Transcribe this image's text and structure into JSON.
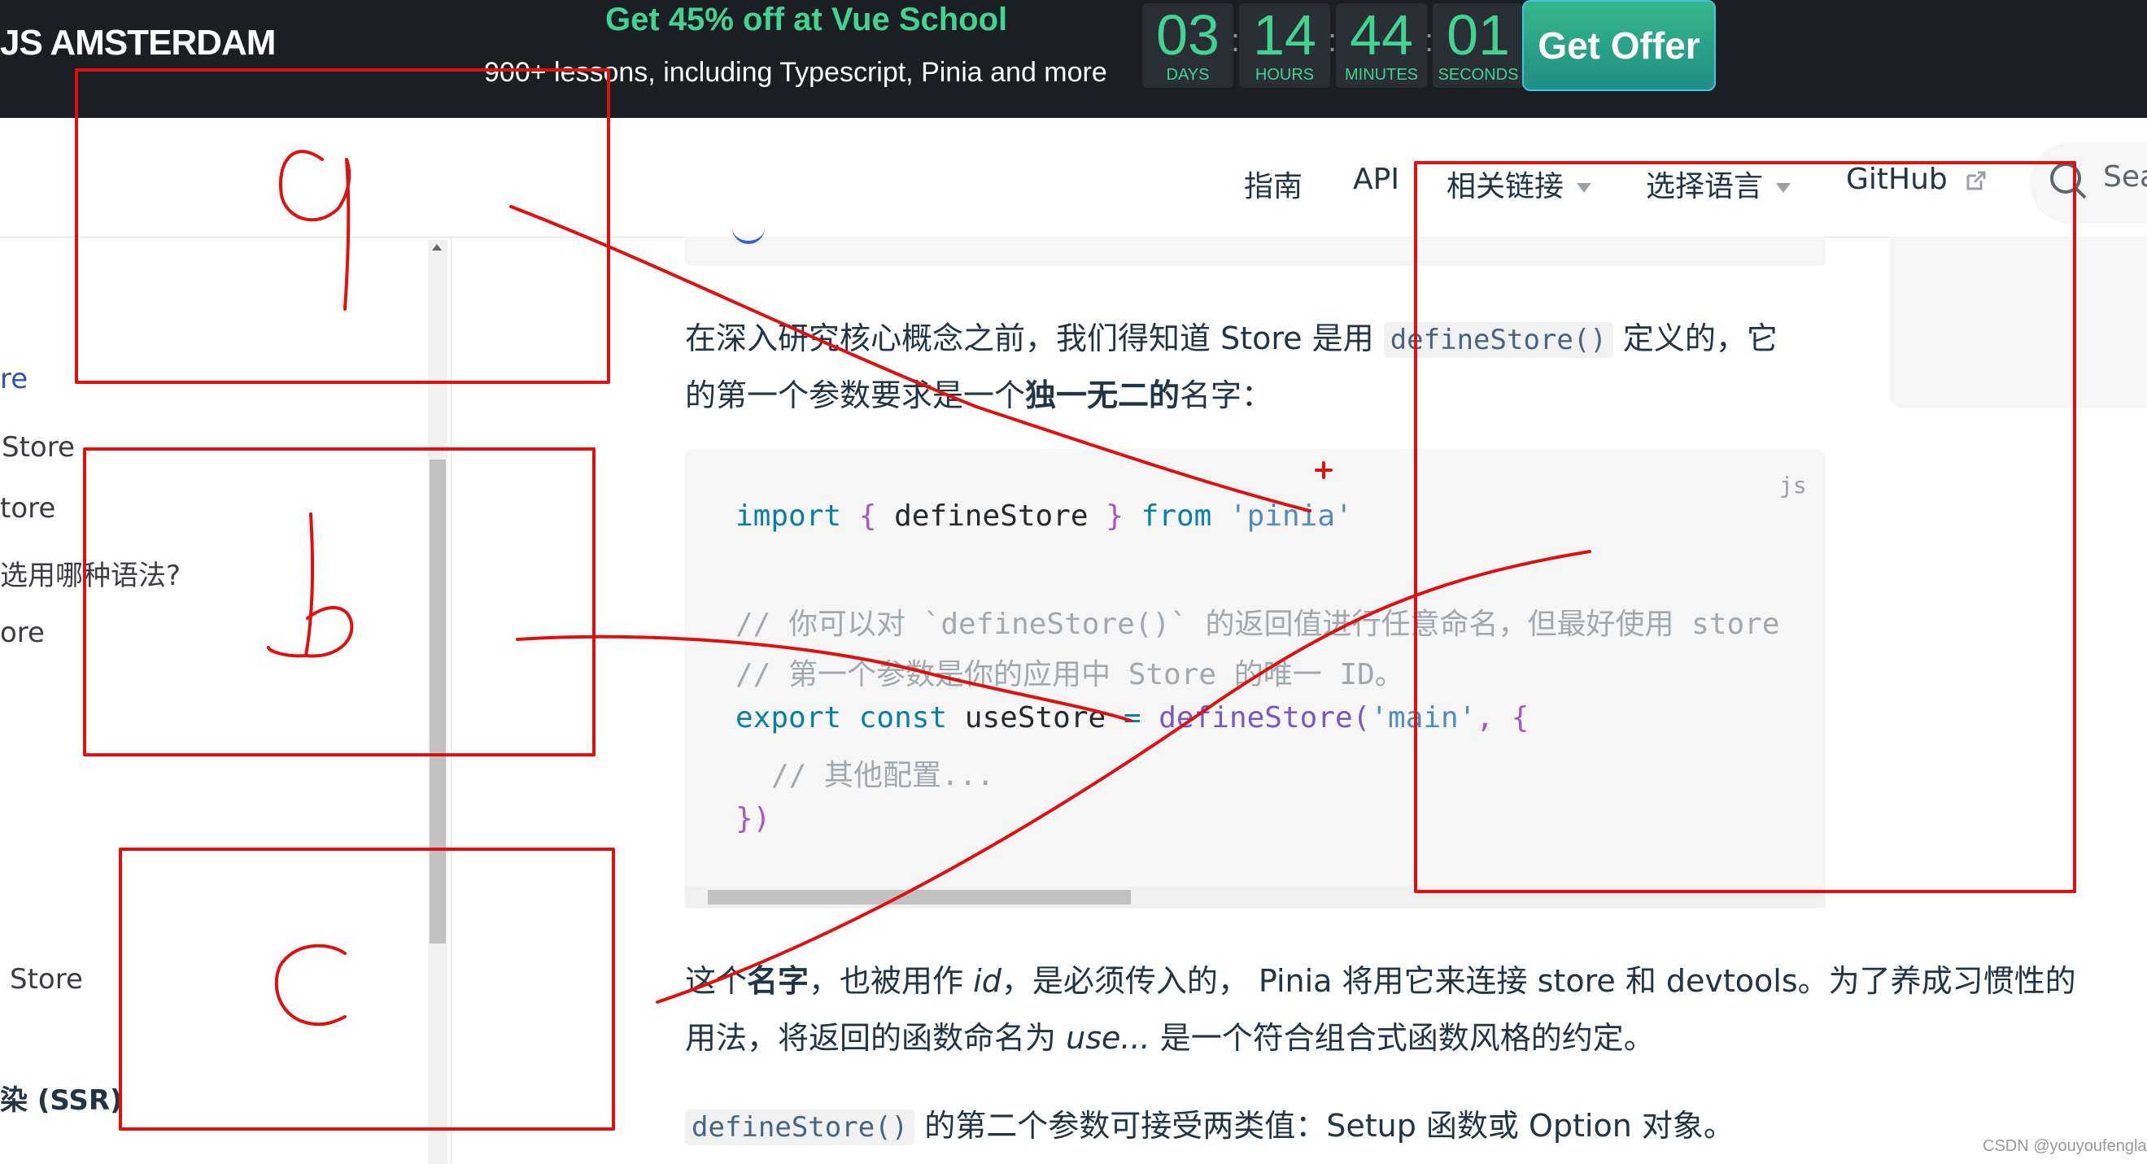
{
  "banner": {
    "brand": "JS AMSTERDAM",
    "promo_title": "Get 45% off at Vue School",
    "promo_sub": "900+ lessons, including Typescript, Pinia and more",
    "countdown": [
      {
        "value": "03",
        "label": "DAYS"
      },
      {
        "value": "14",
        "label": "HOURS"
      },
      {
        "value": "44",
        "label": "MINUTES"
      },
      {
        "value": "01",
        "label": "SECONDS"
      }
    ],
    "separator": ":",
    "offer_label": "Get Offer"
  },
  "nav": {
    "items": [
      {
        "label": "指南"
      },
      {
        "label": "API"
      },
      {
        "label": "相关链接"
      },
      {
        "label": "选择语言"
      },
      {
        "label": "GitHub"
      }
    ],
    "search_placeholder": "Sea"
  },
  "sidebar": {
    "items": [
      "re",
      "Store",
      "tore",
      "选用哪种语法?",
      "ore",
      "Store",
      "染 (SSR)"
    ]
  },
  "content": {
    "para1_line1_pre": "在深入研究核心概念之前，我们得知道 Store 是用",
    "para1_code": "defineStore()",
    "para1_line1_post": "定义的，它",
    "para1_line2_pre": "的第一个参数要求是一个",
    "para1_line2_bold": "独一无二的",
    "para1_line2_post": "名字：",
    "code_lang": "js",
    "code": {
      "l1_import": "import",
      "l1_open": "{",
      "l1_name": "defineStore",
      "l1_close": "}",
      "l1_from": "from",
      "l1_module": "'pinia'",
      "l2_comment": "// 你可以对 `defineStore()` 的返回值进行任意命名，但最好使用 store",
      "l3_comment": "// 第一个参数是你的应用中 Store 的唯一 ID。",
      "l4_export": "export",
      "l4_const": "const",
      "l4_var": "useStore",
      "l4_eq": "=",
      "l4_fn": "defineStore(",
      "l4_arg": "'main'",
      "l4_tail": ", {",
      "l5_comment": "// 其他配置...",
      "l6_close": "})"
    },
    "para2_line1_pre": "这个",
    "para2_line1_bold": "名字",
    "para2_line1_mid": "，也被用作",
    "para2_line1_id": "id",
    "para2_line1_post": "，是必须传入的， Pinia 将用它来连接 store 和 devtools。为了养成习惯性的",
    "para2_line2_pre": "用法，将返回的函数命名为",
    "para2_line2_use": "use...",
    "para2_line2_post": "是一个符合组合式函数风格的约定。",
    "para3_code": "defineStore()",
    "para3_post": "的第二个参数可接受两类值：Setup 函数或 Option 对象。"
  },
  "annotations": {
    "labels": [
      "a",
      "b",
      "c"
    ],
    "mark": "+",
    "stroke_color": "#e01010"
  },
  "watermark": "CSDN @youyoufenglai"
}
